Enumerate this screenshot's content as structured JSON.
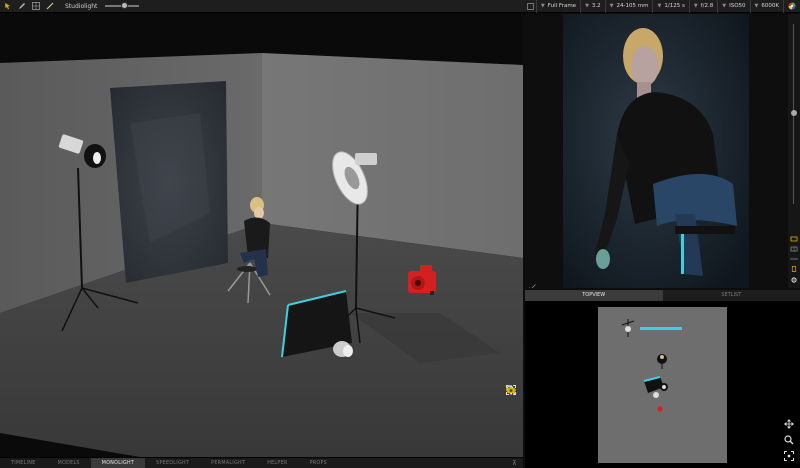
{
  "toolbar": {
    "preset_label": "Studiolight",
    "slider_value": 0.55,
    "icons": [
      "select-icon",
      "pen-icon",
      "grid-icon",
      "wand-icon"
    ]
  },
  "camera": {
    "format": "Full Frame",
    "crop": "3.2",
    "lens": "24-105 mm",
    "shutter": "1/125 s",
    "aperture": "f/2.8",
    "iso": "ISO50",
    "white_balance": "6000K"
  },
  "bottom_tabs": [
    "TIMELINE",
    "MODELS",
    "MONOLIGHT",
    "SPEEDLIGHT",
    "PERMALIGHT",
    "HELPER",
    "PROPS"
  ],
  "active_bottom_tab": "MONOLIGHT",
  "panel_tabs": {
    "topview": "TOPVIEW",
    "setlist": "SETLIST"
  },
  "colors": {
    "accent_cyan": "#3fd0e0",
    "camera_red": "#d42020",
    "highlight_yellow": "#e2b000",
    "tab_active": "#3a3a3a",
    "toolbar": "#1e1e1e"
  }
}
